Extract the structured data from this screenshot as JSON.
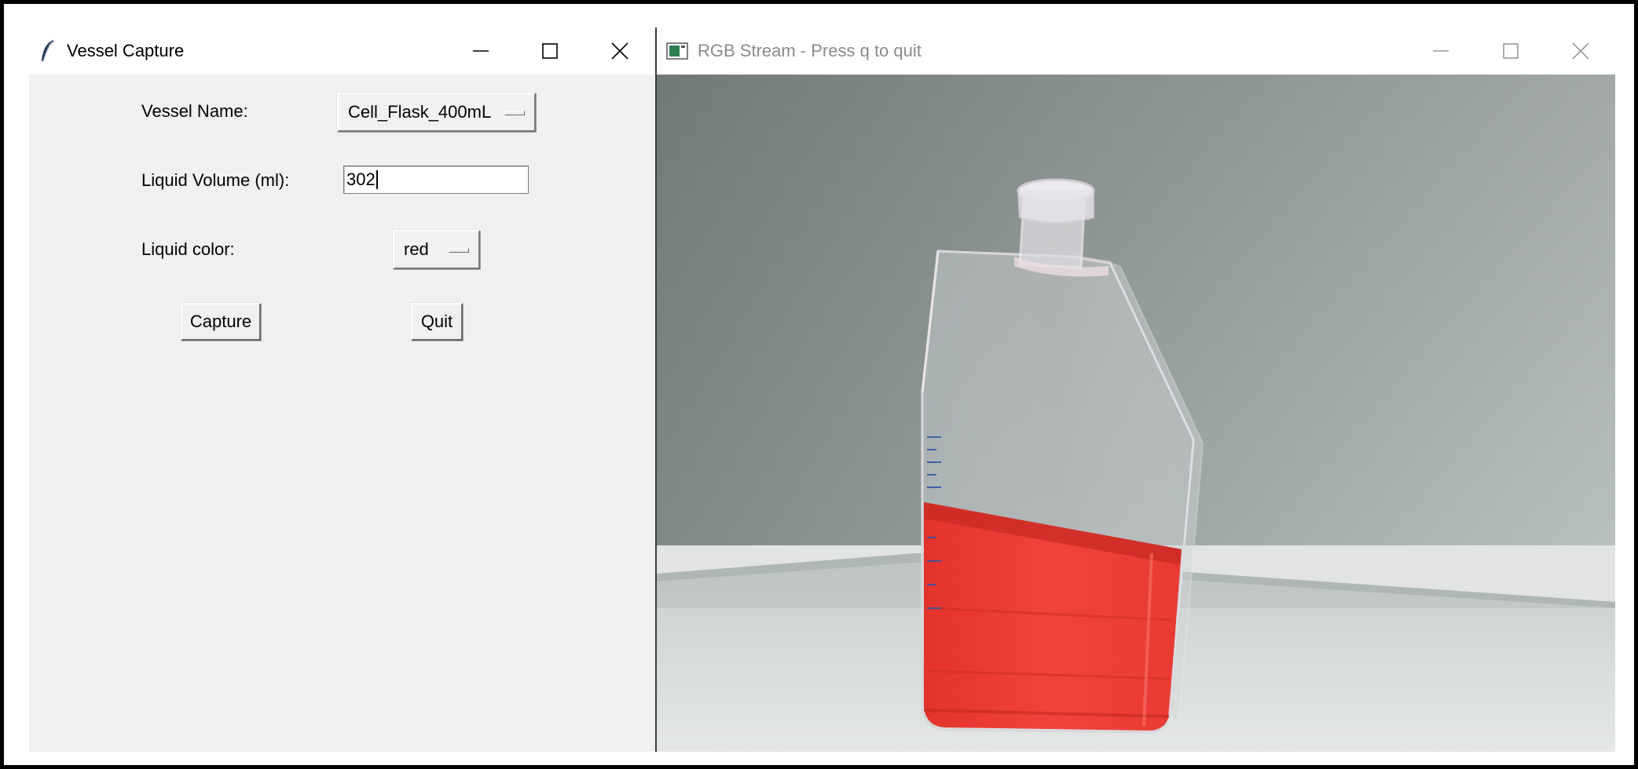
{
  "left_window": {
    "title": "Vessel Capture",
    "vessel_name_label": "Vessel Name:",
    "vessel_name_value": "Cell_Flask_400mL",
    "liquid_volume_label": "Liquid Volume (ml):",
    "liquid_volume_value": "302",
    "liquid_color_label": "Liquid color:",
    "liquid_color_value": "red",
    "capture_label": "Capture",
    "quit_label": "Quit"
  },
  "right_window": {
    "title": "RGB Stream - Press q to quit"
  },
  "colors": {
    "liquid": "#f0433c",
    "tk_background": "#f0f0f0"
  }
}
